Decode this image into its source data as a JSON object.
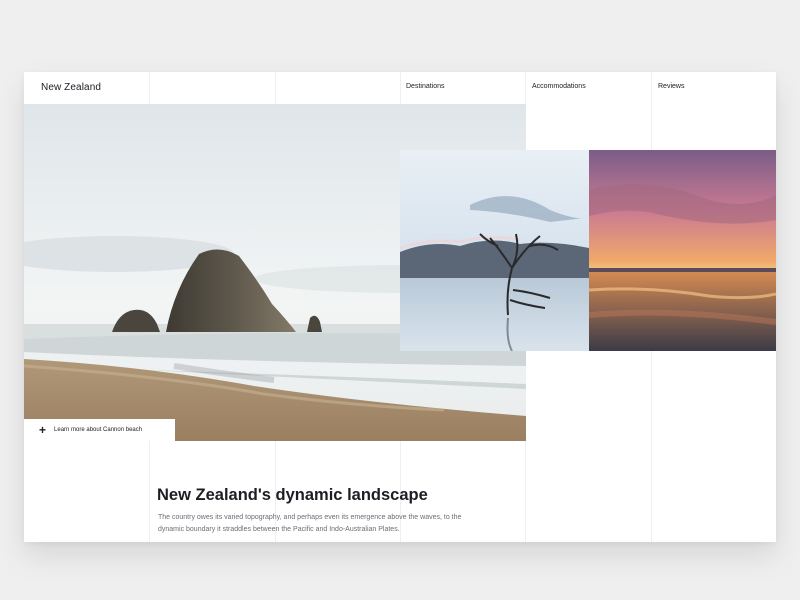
{
  "header": {
    "brand": "New Zealand",
    "nav": [
      {
        "label": "Destinations"
      },
      {
        "label": "Accommodations"
      },
      {
        "label": "Reviews"
      }
    ]
  },
  "hero": {
    "learn_more_label": "Learn more about Cannon beach",
    "plus_icon": "+"
  },
  "article": {
    "title": "New Zealand's dynamic landscape",
    "body": "The country owes its varied topography, and perhaps even its emergence above the waves, to the dynamic boundary it straddles between the Pacific and Indo-Australian Plates."
  },
  "colors": {
    "background": "#efeff0",
    "card": "#ffffff",
    "text_primary": "#1d1d24",
    "text_secondary": "#6d6e75"
  }
}
